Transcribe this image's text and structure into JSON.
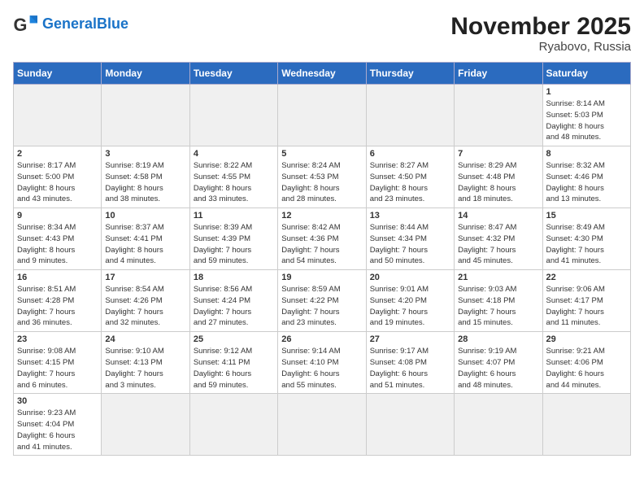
{
  "logo": {
    "general": "General",
    "blue": "Blue"
  },
  "title": "November 2025",
  "location": "Ryabovo, Russia",
  "days_header": [
    "Sunday",
    "Monday",
    "Tuesday",
    "Wednesday",
    "Thursday",
    "Friday",
    "Saturday"
  ],
  "weeks": [
    [
      {
        "day": null,
        "empty": true
      },
      {
        "day": null,
        "empty": true
      },
      {
        "day": null,
        "empty": true
      },
      {
        "day": null,
        "empty": true
      },
      {
        "day": null,
        "empty": true
      },
      {
        "day": null,
        "empty": true
      },
      {
        "day": 1,
        "info": "Sunrise: 8:14 AM\nSunset: 5:03 PM\nDaylight: 8 hours\nand 48 minutes."
      }
    ],
    [
      {
        "day": 2,
        "info": "Sunrise: 8:17 AM\nSunset: 5:00 PM\nDaylight: 8 hours\nand 43 minutes."
      },
      {
        "day": 3,
        "info": "Sunrise: 8:19 AM\nSunset: 4:58 PM\nDaylight: 8 hours\nand 38 minutes."
      },
      {
        "day": 4,
        "info": "Sunrise: 8:22 AM\nSunset: 4:55 PM\nDaylight: 8 hours\nand 33 minutes."
      },
      {
        "day": 5,
        "info": "Sunrise: 8:24 AM\nSunset: 4:53 PM\nDaylight: 8 hours\nand 28 minutes."
      },
      {
        "day": 6,
        "info": "Sunrise: 8:27 AM\nSunset: 4:50 PM\nDaylight: 8 hours\nand 23 minutes."
      },
      {
        "day": 7,
        "info": "Sunrise: 8:29 AM\nSunset: 4:48 PM\nDaylight: 8 hours\nand 18 minutes."
      },
      {
        "day": 8,
        "info": "Sunrise: 8:32 AM\nSunset: 4:46 PM\nDaylight: 8 hours\nand 13 minutes."
      }
    ],
    [
      {
        "day": 9,
        "info": "Sunrise: 8:34 AM\nSunset: 4:43 PM\nDaylight: 8 hours\nand 9 minutes."
      },
      {
        "day": 10,
        "info": "Sunrise: 8:37 AM\nSunset: 4:41 PM\nDaylight: 8 hours\nand 4 minutes."
      },
      {
        "day": 11,
        "info": "Sunrise: 8:39 AM\nSunset: 4:39 PM\nDaylight: 7 hours\nand 59 minutes."
      },
      {
        "day": 12,
        "info": "Sunrise: 8:42 AM\nSunset: 4:36 PM\nDaylight: 7 hours\nand 54 minutes."
      },
      {
        "day": 13,
        "info": "Sunrise: 8:44 AM\nSunset: 4:34 PM\nDaylight: 7 hours\nand 50 minutes."
      },
      {
        "day": 14,
        "info": "Sunrise: 8:47 AM\nSunset: 4:32 PM\nDaylight: 7 hours\nand 45 minutes."
      },
      {
        "day": 15,
        "info": "Sunrise: 8:49 AM\nSunset: 4:30 PM\nDaylight: 7 hours\nand 41 minutes."
      }
    ],
    [
      {
        "day": 16,
        "info": "Sunrise: 8:51 AM\nSunset: 4:28 PM\nDaylight: 7 hours\nand 36 minutes."
      },
      {
        "day": 17,
        "info": "Sunrise: 8:54 AM\nSunset: 4:26 PM\nDaylight: 7 hours\nand 32 minutes."
      },
      {
        "day": 18,
        "info": "Sunrise: 8:56 AM\nSunset: 4:24 PM\nDaylight: 7 hours\nand 27 minutes."
      },
      {
        "day": 19,
        "info": "Sunrise: 8:59 AM\nSunset: 4:22 PM\nDaylight: 7 hours\nand 23 minutes."
      },
      {
        "day": 20,
        "info": "Sunrise: 9:01 AM\nSunset: 4:20 PM\nDaylight: 7 hours\nand 19 minutes."
      },
      {
        "day": 21,
        "info": "Sunrise: 9:03 AM\nSunset: 4:18 PM\nDaylight: 7 hours\nand 15 minutes."
      },
      {
        "day": 22,
        "info": "Sunrise: 9:06 AM\nSunset: 4:17 PM\nDaylight: 7 hours\nand 11 minutes."
      }
    ],
    [
      {
        "day": 23,
        "info": "Sunrise: 9:08 AM\nSunset: 4:15 PM\nDaylight: 7 hours\nand 6 minutes."
      },
      {
        "day": 24,
        "info": "Sunrise: 9:10 AM\nSunset: 4:13 PM\nDaylight: 7 hours\nand 3 minutes."
      },
      {
        "day": 25,
        "info": "Sunrise: 9:12 AM\nSunset: 4:11 PM\nDaylight: 6 hours\nand 59 minutes."
      },
      {
        "day": 26,
        "info": "Sunrise: 9:14 AM\nSunset: 4:10 PM\nDaylight: 6 hours\nand 55 minutes."
      },
      {
        "day": 27,
        "info": "Sunrise: 9:17 AM\nSunset: 4:08 PM\nDaylight: 6 hours\nand 51 minutes."
      },
      {
        "day": 28,
        "info": "Sunrise: 9:19 AM\nSunset: 4:07 PM\nDaylight: 6 hours\nand 48 minutes."
      },
      {
        "day": 29,
        "info": "Sunrise: 9:21 AM\nSunset: 4:06 PM\nDaylight: 6 hours\nand 44 minutes."
      }
    ],
    [
      {
        "day": 30,
        "info": "Sunrise: 9:23 AM\nSunset: 4:04 PM\nDaylight: 6 hours\nand 41 minutes."
      },
      {
        "day": null,
        "empty": true
      },
      {
        "day": null,
        "empty": true
      },
      {
        "day": null,
        "empty": true
      },
      {
        "day": null,
        "empty": true
      },
      {
        "day": null,
        "empty": true
      },
      {
        "day": null,
        "empty": true
      }
    ]
  ]
}
